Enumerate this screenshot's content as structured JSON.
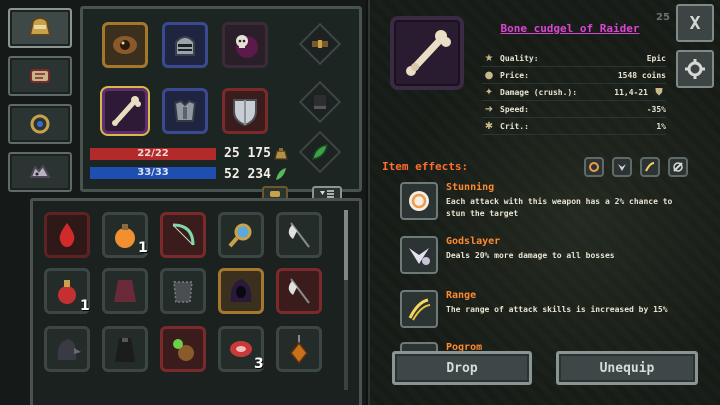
{
  "inventory_counts": {
    "potion": "1",
    "red_potion": "1",
    "meat": "3"
  },
  "resources": {
    "health": "22/22",
    "mana": "33/33",
    "gold": "25 175",
    "herbs": "52 234"
  },
  "item": {
    "title": "Bone cudgel of Raider",
    "level": "25",
    "stats": [
      {
        "icon": "star-icon",
        "key": "Quality:",
        "value": "Epic"
      },
      {
        "icon": "coin-icon",
        "key": "Price:",
        "value": "1548 coins"
      },
      {
        "icon": "damage-icon",
        "key": "Damage (crush.):",
        "value": "11,4-21"
      },
      {
        "icon": "speed-icon",
        "key": "Speed:",
        "value": "-35%"
      },
      {
        "icon": "crit-icon",
        "key": "Crit.:",
        "value": "1%"
      }
    ]
  },
  "effects": {
    "title": "Item effects:",
    "list": [
      {
        "name": "Stunning",
        "desc": "Each attack with this weapon has a 2% chance to stun the target"
      },
      {
        "name": "Godslayer",
        "desc": "Deals 20% more damage to all bosses"
      },
      {
        "name": "Range",
        "desc": "The range of attack skills is increased by 15%"
      },
      {
        "name": "Pogrom",
        "desc": ""
      }
    ]
  },
  "buttons": {
    "close": "X",
    "drop": "Drop",
    "unequip": "Unequip"
  },
  "colors": {
    "title": "#d946d1",
    "effects": "#ff6e2e",
    "health": "#b22a2a",
    "mana": "#1e4fb0"
  }
}
